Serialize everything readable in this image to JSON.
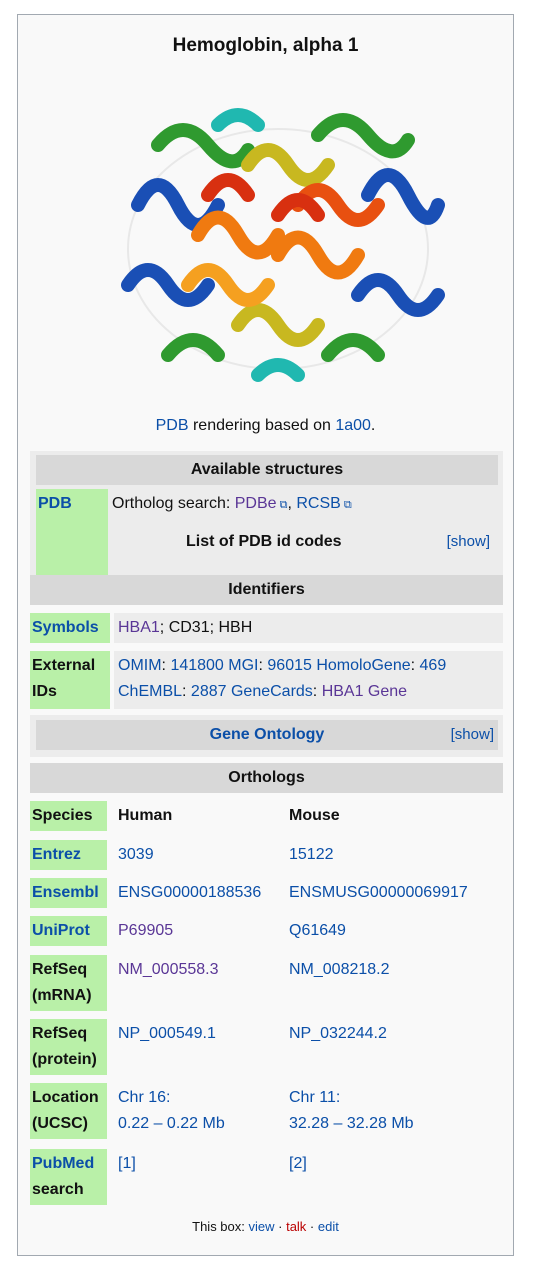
{
  "title": "Hemoglobin, alpha 1",
  "caption": {
    "link1": "PDB",
    "mid": " rendering based on ",
    "link2": "1a00",
    "end": "."
  },
  "image": {
    "alt": "protein-structure"
  },
  "structures": {
    "header": "Available structures",
    "label": "PDB",
    "ortholog_prefix": "Ortholog search: ",
    "pdbe": "PDBe",
    "sep": ", ",
    "rcsb": "RCSB",
    "list_label": "List of PDB id codes",
    "show": "[show]"
  },
  "identifiers": {
    "header": "Identifiers",
    "symbols_label": "Symbols",
    "symbols": {
      "s1": "HBA1",
      "rest": "; CD31; HBH"
    },
    "ext_label1": "External",
    "ext_label2": "IDs",
    "ext_line1": {
      "a": "OMIM",
      "b": ": ",
      "c": "141800",
      "d": " ",
      "e": "MGI",
      "f": ": ",
      "g": "96015",
      "h": " ",
      "i": "HomoloGene",
      "j": ": ",
      "k": "469"
    },
    "ext_line2": {
      "a": "ChEMBL",
      "b": ": ",
      "c": "2887",
      "d": " ",
      "e": "GeneCards",
      "f": ": ",
      "g": "HBA1 Gene"
    }
  },
  "gene_ontology": {
    "label": "Gene Ontology",
    "show": "[show]"
  },
  "orthologs": {
    "header": "Orthologs",
    "species_label": "Species",
    "human": "Human",
    "mouse": "Mouse",
    "rows": [
      {
        "label1": "Entrez",
        "label2": "",
        "human": "3039",
        "mouse": "15122"
      },
      {
        "label1": "Ensembl",
        "label2": "",
        "human": "ENSG00000188536",
        "mouse": "ENSMUSG00000069917"
      },
      {
        "label1": "UniProt",
        "label2": "",
        "human": "P69905",
        "mouse": "Q61649"
      },
      {
        "label1": "RefSeq",
        "label2": "(mRNA)",
        "human": "NM_000558.3",
        "mouse": "NM_008218.2"
      },
      {
        "label1": "RefSeq",
        "label2": "(protein)",
        "human": "NP_000549.1",
        "mouse": "NP_032244.2"
      },
      {
        "label1": "Location",
        "label2": "(UCSC)",
        "human": "Chr 16:",
        "human2": "0.22 – 0.22 Mb",
        "mouse": "Chr 11:",
        "mouse2": "32.28 – 32.28 Mb"
      },
      {
        "label1": "PubMed",
        "label2": "search",
        "human": "[1]",
        "mouse": "[2]"
      }
    ]
  },
  "footer": {
    "prefix": "This box: ",
    "view": "view",
    "dot": " · ",
    "talk": "talk",
    "edit": "edit"
  },
  "colors": {
    "green": "#b9f0a8",
    "header": "#d8d8d8",
    "link": "#0b4fa8",
    "red": "#ba0000"
  }
}
